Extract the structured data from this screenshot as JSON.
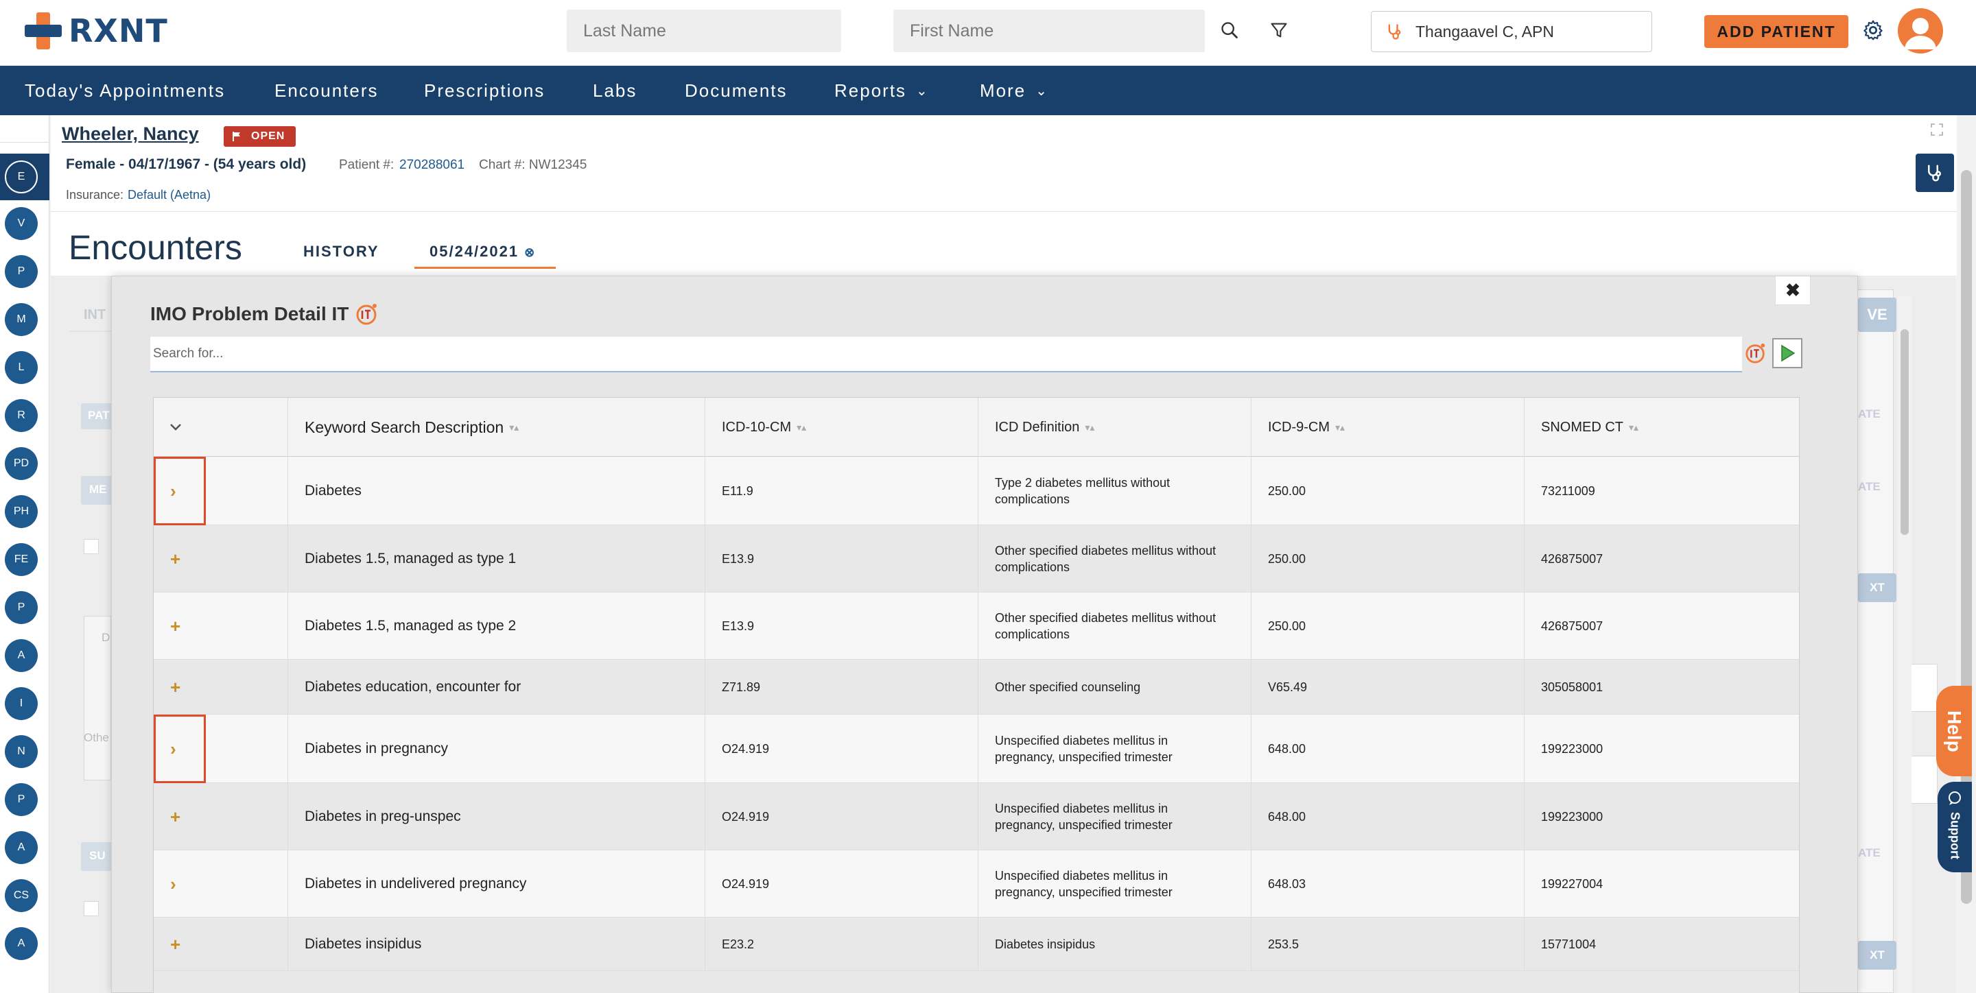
{
  "header": {
    "logo_text": "RXNT",
    "last_name_placeholder": "Last Name",
    "first_name_placeholder": "First Name",
    "provider": "Thangaavel C, APN",
    "add_patient": "ADD PATIENT"
  },
  "nav": {
    "items": [
      {
        "label": "Today's Appointments"
      },
      {
        "label": "Encounters"
      },
      {
        "label": "Prescriptions"
      },
      {
        "label": "Labs"
      },
      {
        "label": "Documents"
      },
      {
        "label": "Reports"
      },
      {
        "label": "More"
      }
    ]
  },
  "rail": [
    "E",
    "V",
    "P",
    "M",
    "L",
    "R",
    "PD",
    "PH",
    "FE",
    "P",
    "A",
    "I",
    "N",
    "P",
    "A",
    "CS",
    "A"
  ],
  "patient": {
    "name": "Wheeler, Nancy",
    "status": "OPEN",
    "demographics": "Female - 04/17/1967 - (54 years old)",
    "patient_num_label": "Patient #:",
    "patient_num": "270288061",
    "chart_num": "Chart #: NW12345",
    "insurance_label": "Insurance:",
    "insurance": "Default (Aetna)"
  },
  "encounters": {
    "title": "Encounters",
    "tab_history": "HISTORY",
    "tab_date": "05/24/2021"
  },
  "background": {
    "tab_text": "INT",
    "btn1": "PAT",
    "btn2": "ME",
    "btn3": "SU",
    "d_text": "D",
    "other_text": "Othe",
    "right_btn": "VE",
    "right_date1": "ATE",
    "right_date2": "ATE",
    "right_next1": "XT",
    "right_date3": "ATE",
    "right_next2": "XT"
  },
  "modal": {
    "title": "IMO Problem Detail IT",
    "search_placeholder": "Search for...",
    "columns": [
      "Keyword Search Description",
      "ICD-10-CM",
      "ICD Definition",
      "ICD-9-CM",
      "SNOMED CT"
    ],
    "rows": [
      {
        "expander": "›",
        "desc": "Diabetes",
        "icd10": "E11.9",
        "def": "Type 2 diabetes mellitus without complications",
        "icd9": "250.00",
        "snomed": "73211009"
      },
      {
        "expander": "+",
        "desc": "Diabetes 1.5, managed as type 1",
        "icd10": "E13.9",
        "def": "Other specified diabetes mellitus without complications",
        "icd9": "250.00",
        "snomed": "426875007"
      },
      {
        "expander": "+",
        "desc": "Diabetes 1.5, managed as type 2",
        "icd10": "E13.9",
        "def": "Other specified diabetes mellitus without complications",
        "icd9": "250.00",
        "snomed": "426875007"
      },
      {
        "expander": "+",
        "desc": "Diabetes education, encounter for",
        "icd10": "Z71.89",
        "def": "Other specified counseling",
        "icd9": "V65.49",
        "snomed": "305058001"
      },
      {
        "expander": "›",
        "desc": "Diabetes in pregnancy",
        "icd10": "O24.919",
        "def": "Unspecified diabetes mellitus in pregnancy, unspecified trimester",
        "icd9": "648.00",
        "snomed": "199223000"
      },
      {
        "expander": "+",
        "desc": "Diabetes in preg-unspec",
        "icd10": "O24.919",
        "def": "Unspecified diabetes mellitus in pregnancy, unspecified trimester",
        "icd9": "648.00",
        "snomed": "199223000"
      },
      {
        "expander": "›",
        "desc": "Diabetes in undelivered pregnancy",
        "icd10": "O24.919",
        "def": "Unspecified diabetes mellitus in pregnancy, unspecified trimester",
        "icd9": "648.03",
        "snomed": "199227004"
      },
      {
        "expander": "+",
        "desc": "Diabetes insipidus",
        "icd10": "E23.2",
        "def": "Diabetes insipidus",
        "icd9": "253.5",
        "snomed": "15771004"
      }
    ]
  },
  "help": "Help",
  "support": "Support",
  "colors": {
    "brand_navy": "#19406a",
    "brand_orange": "#ef7b3a",
    "highlight_red": "#e04a2c"
  }
}
